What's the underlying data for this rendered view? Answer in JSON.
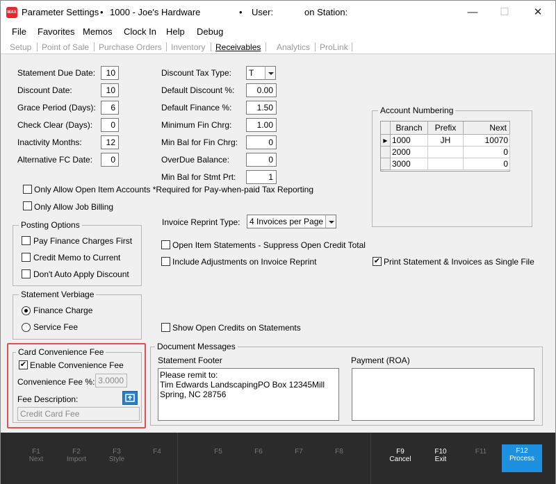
{
  "titlebar": {
    "app_icon": "MAX",
    "title": "Parameter Settings",
    "company": "1000 - Joe's Hardware",
    "user_label": "User:",
    "station_label": "on Station:",
    "minimize": "—",
    "maximize": "☐",
    "close": "✕"
  },
  "menu": [
    "File",
    "Favorites",
    "Memos",
    "Clock In",
    "Help",
    "Debug"
  ],
  "tabs": [
    "Setup",
    "Point of Sale",
    "Purchase Orders",
    "Inventory",
    "Receivables",
    "Analytics",
    "ProLink"
  ],
  "active_tab": "Receivables",
  "left_fields": [
    {
      "label": "Statement Due Date:",
      "value": "10"
    },
    {
      "label": "Discount Date:",
      "value": "10"
    },
    {
      "label": "Grace Period (Days):",
      "value": "6"
    },
    {
      "label": "Check Clear (Days):",
      "value": "0"
    },
    {
      "label": "Inactivity Months:",
      "value": "12"
    },
    {
      "label": "Alternative FC Date:",
      "value": "0"
    }
  ],
  "mid_fields": [
    {
      "label": "Discount Tax Type:",
      "value": "T"
    },
    {
      "label": "Default Discount %:",
      "value": "0.00"
    },
    {
      "label": "Default Finance %:",
      "value": "1.50"
    },
    {
      "label": "Minimum Fin Chrg:",
      "value": "1.00"
    },
    {
      "label": "Min Bal for Fin Chrg:",
      "value": "0"
    },
    {
      "label": "OverDue Balance:",
      "value": "0"
    },
    {
      "label": "Min Bal for Stmt Prt:",
      "value": "1"
    }
  ],
  "account_numbering": {
    "title": "Account Numbering",
    "columns": [
      "Branch",
      "Prefix",
      "Next"
    ],
    "rows": [
      {
        "branch": "1000",
        "prefix": "JH",
        "next": "10070",
        "current": "▶"
      },
      {
        "branch": "2000",
        "prefix": "",
        "next": "0",
        "current": ""
      },
      {
        "branch": "3000",
        "prefix": "",
        "next": "0",
        "current": ""
      }
    ]
  },
  "checks_top": [
    {
      "label": "Only Allow Open Item Accounts *Required for Pay-when-paid Tax Reporting",
      "checked": false
    },
    {
      "label": "Only Allow Job Billing",
      "checked": false
    }
  ],
  "posting_options": {
    "title": "Posting Options",
    "items": [
      {
        "label": "Pay Finance Charges First",
        "checked": false
      },
      {
        "label": "Credit Memo to Current",
        "checked": false
      },
      {
        "label": "Don't Auto Apply Discount",
        "checked": false
      }
    ]
  },
  "invoice_reprint": {
    "label": "Invoice Reprint Type:",
    "value": "4 Invoices per Page"
  },
  "mid_checks": [
    {
      "label": "Open Item Statements - Suppress Open Credit Total",
      "checked": false
    },
    {
      "label": "Include Adjustments on Invoice Reprint",
      "checked": false
    }
  ],
  "print_single": {
    "label": "Print Statement & Invoices as Single File",
    "checked": true,
    "mark": "✔"
  },
  "statement_verbiage": {
    "title": "Statement Verbiage",
    "options": [
      {
        "label": "Finance Charge",
        "selected": true
      },
      {
        "label": "Service Fee",
        "selected": false
      }
    ]
  },
  "show_open_credits": {
    "label": "Show Open Credits on Statements",
    "checked": false
  },
  "card_fee": {
    "title": "Card Convenience Fee",
    "enable_label": "Enable Convenience Fee",
    "enable_checked": true,
    "enable_mark": "✔",
    "fee_pct_label": "Convenience Fee %:",
    "fee_pct_value": "3.0000",
    "desc_label": "Fee Description:",
    "desc_value": "Credit Card Fee",
    "highlight_color": "#e05050"
  },
  "document_messages": {
    "title": "Document Messages",
    "footer_label": "Statement Footer",
    "footer_text": "Please remit to:\nTim Edwards LandscapingPO Box 12345Mill\nSpring, NC 28756",
    "payment_label": "Payment (ROA)",
    "payment_text": ""
  },
  "fkeys": [
    {
      "key": "F1",
      "action": "Next",
      "enabled": false
    },
    {
      "key": "F2",
      "action": "Import",
      "enabled": false
    },
    {
      "key": "F3",
      "action": "Style",
      "enabled": false
    },
    {
      "key": "F4",
      "action": "",
      "enabled": false
    },
    {
      "key": "F5",
      "action": "",
      "enabled": false
    },
    {
      "key": "F6",
      "action": "",
      "enabled": false
    },
    {
      "key": "F7",
      "action": "",
      "enabled": false
    },
    {
      "key": "F8",
      "action": "",
      "enabled": false
    },
    {
      "key": "F9",
      "action": "Cancel",
      "enabled": true
    },
    {
      "key": "F10",
      "action": "Exit",
      "enabled": true
    },
    {
      "key": "F11",
      "action": "",
      "enabled": false
    },
    {
      "key": "F12",
      "action": "Process",
      "enabled": true
    }
  ],
  "colors": {
    "primary_button": "#1e90e0",
    "fbar": "#2b2b2b"
  }
}
